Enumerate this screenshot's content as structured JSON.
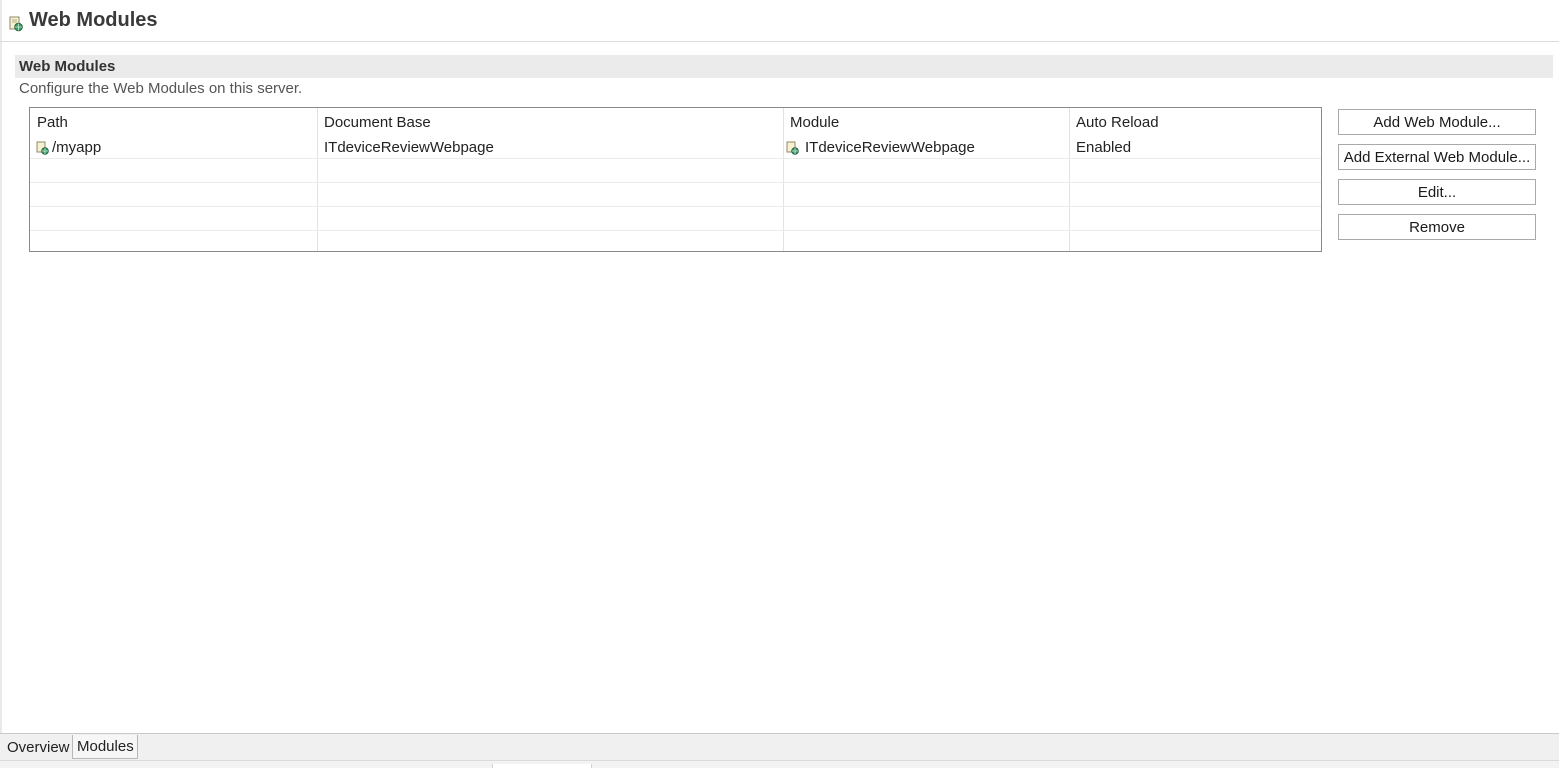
{
  "editor": {
    "title": "Web Modules",
    "icon": "web-module-icon"
  },
  "section": {
    "title": "Web Modules",
    "description": "Configure the Web Modules on this server."
  },
  "table": {
    "headers": [
      "Path",
      "Document Base",
      "Module",
      "Auto Reload"
    ],
    "rows": [
      {
        "path": "/myapp",
        "path_icon": "web-module-icon",
        "document_base": "ITdeviceReviewWebpage",
        "module": "ITdeviceReviewWebpage",
        "module_icon": "web-module-icon",
        "auto_reload": "Enabled"
      }
    ]
  },
  "buttons": {
    "add_web_module": "Add Web Module...",
    "add_external_web_module": "Add External Web Module...",
    "edit": "Edit...",
    "remove": "Remove"
  },
  "tabs": {
    "overview": "Overview",
    "modules": "Modules",
    "active": "Modules"
  }
}
